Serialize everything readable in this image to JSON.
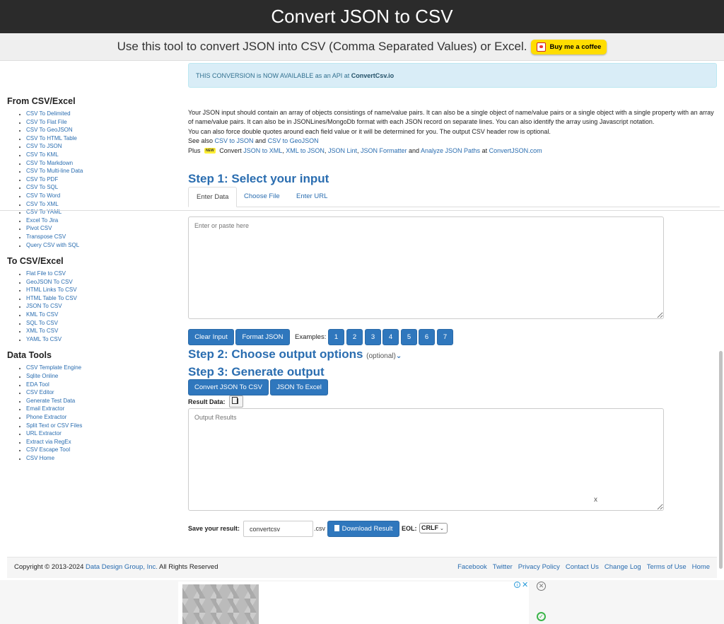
{
  "header": {
    "title": "Convert JSON to CSV",
    "tagline": "Use this tool to convert JSON into CSV (Comma Separated Values) or Excel.",
    "bmc_label": "Buy me a coffee"
  },
  "api_alert": {
    "text": "THIS CONVERSION is NOW AVAILABLE as an API at ",
    "link": "ConvertCsv.io"
  },
  "sidebar": {
    "sections": [
      {
        "heading": "From CSV/Excel",
        "items": [
          "CSV To Delimited",
          "CSV To Flat File",
          "CSV To GeoJSON",
          "CSV To HTML Table",
          "CSV To JSON",
          "CSV To KML",
          "CSV To Markdown",
          "CSV To Multi-line Data",
          "CSV To PDF",
          "CSV To SQL",
          "CSV To Word",
          "CSV To XML",
          "CSV To YAML",
          "Excel To Jira",
          "Pivot CSV",
          "Transpose CSV",
          "Query CSV with SQL"
        ]
      },
      {
        "heading": "To CSV/Excel",
        "items": [
          "Flat File to CSV",
          "GeoJSON To CSV",
          "HTML Links To CSV",
          "HTML Table To CSV",
          "JSON To CSV",
          "KML To CSV",
          "SQL To CSV",
          "XML To CSV",
          "YAML To CSV"
        ]
      },
      {
        "heading": "Data Tools",
        "items": [
          "CSV Template Engine",
          "Sqlite Online",
          "EDA Tool",
          "CSV Editor",
          "Generate Test Data",
          "Email Extractor",
          "Phone Extractor",
          "Split Text or CSV Files",
          "URL Extractor",
          "Extract via RegEx",
          "CSV Escape Tool",
          "CSV Home"
        ]
      }
    ]
  },
  "intro": {
    "paragraph1": "Your JSON input should contain an array of objects consistings of name/value pairs. It can also be a single object of name/value pairs or a single object with a single property with an array of name/value pairs. It can also be in JSONLines/MongoDb format with each JSON record on separate lines. You can also identify the array using Javascript notation.",
    "paragraph2": "You can also force double quotes around each field value or it will be determined for you. The output CSV header row is optional.",
    "see_also_prefix": "See also ",
    "see_also_link1": "CSV to JSON",
    "and": " and ",
    "see_also_link2": "CSV to GeoJSON",
    "plus_prefix": "Plus ",
    "new_badge": "NEW",
    "convert_word": " Convert ",
    "plus_link1": "JSON to XML",
    "comma": ", ",
    "plus_link2": "XML to JSON",
    "plus_link3": "JSON Lint",
    "plus_link4": "JSON Formatter",
    "plus_and": " and ",
    "plus_link5": "Analyze JSON Paths",
    "at": " at ",
    "plus_link6": "ConvertJSON.com"
  },
  "step1": {
    "heading": "Step 1: Select your input",
    "tabs": [
      "Enter Data",
      "Choose File",
      "Enter URL"
    ],
    "placeholder": "Enter or paste here",
    "clear_label": "Clear Input",
    "format_label": "Format JSON",
    "examples_label": "Examples:",
    "examples": [
      "1",
      "2",
      "3",
      "4",
      "5",
      "6",
      "7"
    ]
  },
  "step2": {
    "heading": "Step 2: Choose output options",
    "optional": "(optional)",
    "chevron": "⌄"
  },
  "step3": {
    "heading": "Step 3: Generate output",
    "convert_label": "Convert JSON To CSV",
    "excel_label": "JSON To Excel",
    "result_label": "Result Data:",
    "output_placeholder": "Output Results",
    "output_x": "x"
  },
  "save": {
    "label": "Save your result:",
    "filename": "convertcsv",
    "ext": ".csv",
    "download_label": "Download Result",
    "eol_label": "EOL:",
    "eol_value": "CRLF"
  },
  "footer": {
    "copyright_prefix": "Copyright © 2013-2024 ",
    "company": "Data Design Group, Inc.",
    "rights": " All Rights Reserved",
    "links": [
      "Facebook",
      "Twitter",
      "Privacy Policy",
      "Contact Us",
      "Change Log",
      "Terms of Use",
      "Home"
    ]
  },
  "ad": {
    "choices_icon": "i",
    "close_x": "✕",
    "close_circle": "✕",
    "ok_icon": "✓"
  },
  "colors": {
    "header_bg": "#2b2b2b",
    "link": "#2a6db0",
    "button": "#2f77bd",
    "alert_bg": "#d9edf7",
    "bmc_yellow": "#ffdd00"
  }
}
